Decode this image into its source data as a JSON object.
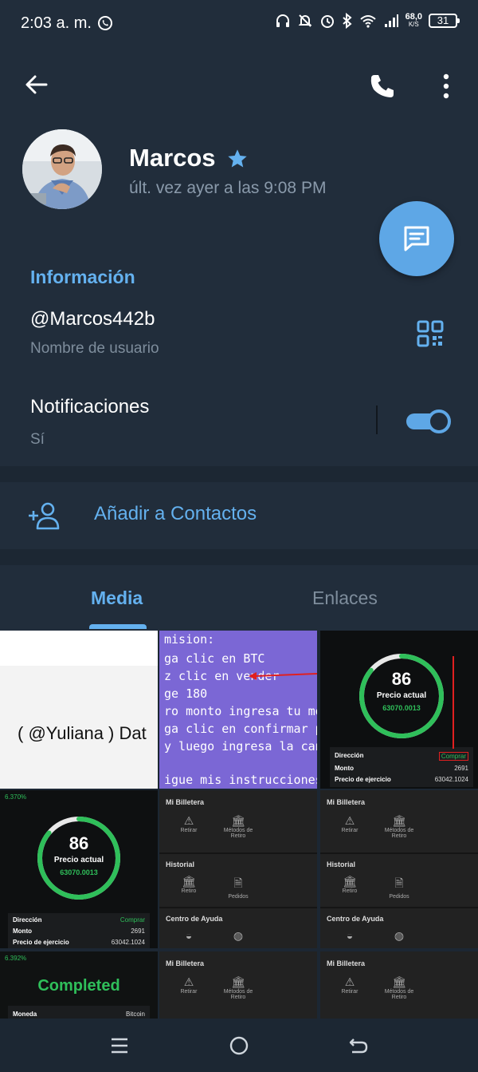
{
  "status_bar": {
    "time": "2:03 a. m.",
    "net_speed": "68,0",
    "net_unit": "K/S",
    "battery": "31",
    "icons": [
      "whatsapp-icon",
      "headphones-icon",
      "mute-icon",
      "alarm-icon",
      "bluetooth-icon",
      "wifi-icon",
      "signal-icon"
    ]
  },
  "header": {
    "name": "Marcos",
    "last_seen": "últ. vez ayer a las 9:08 PM",
    "icons": [
      "back-arrow-icon",
      "phone-icon",
      "more-vertical-icon",
      "star-icon",
      "message-icon"
    ]
  },
  "info": {
    "title": "Información",
    "username": "@Marcos442b",
    "username_label": "Nombre de usuario",
    "notifications_label": "Notificaciones",
    "notifications_value": "Sí",
    "notifications_enabled": true
  },
  "actions": {
    "add_contact": "Añadir a Contactos"
  },
  "tabs": {
    "media": "Media",
    "links": "Enlaces",
    "active": "media"
  },
  "media": {
    "tile1_text": "( @Yuliana ) Dat",
    "tile2_lines": [
      "mision:",
      "ga clic en BTC",
      "z clic en vender",
      "ge 180",
      "ro monto ingresa tu monto",
      "ga clic en confirmar pedido",
      "y luego ingresa la cantidad",
      "",
      "igue mis instrucciones esta"
    ],
    "ring": {
      "number": "86",
      "label": "Precio actual",
      "value": "63070.0013",
      "progress": 0.86
    },
    "tx": {
      "direction_label": "Dirección",
      "direction_value": "Comprar",
      "amount_label": "Monto",
      "amount_value": "2691",
      "strike_label": "Precio de ejercicio",
      "strike_value": "63042.1024"
    },
    "percent_badge": "6.370%",
    "percent_badge2": "6.392%",
    "wallet": {
      "title": "Mi Billetera",
      "withdraw": "Retirar",
      "methods": "Métodos de Retiro",
      "history": "Historial",
      "retiro": "Retiro",
      "orders": "Pedidos",
      "help": "Centro de Ayuda"
    },
    "completed": "Completed",
    "currency_label": "Moneda",
    "currency_value": "Bitcoin"
  },
  "colors": {
    "accent": "#64b1ef",
    "panel": "#212d3b",
    "background": "#1c2733",
    "fab": "#5ea7e6"
  }
}
